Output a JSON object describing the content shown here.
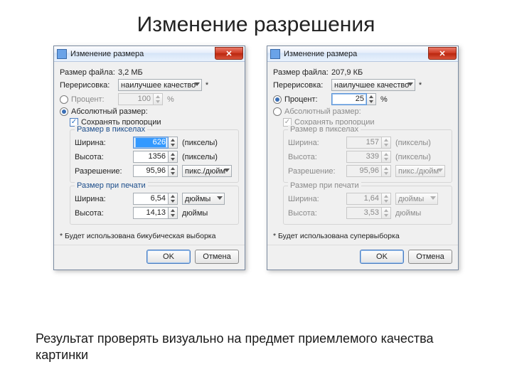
{
  "slide_title": "Изменение разрешения",
  "caption": "Результат проверять визуально на предмет приемлемого качества картинки",
  "common": {
    "window_title": "Изменение размера",
    "file_size_label": "Размер файла:",
    "resample_label": "Перерисовка:",
    "resample_value": "наилучшее качество",
    "percent_label": "Процент:",
    "percent_unit": "%",
    "absolute_label": "Абсолютный размер:",
    "keep_ratio_label": "Сохранять пропорции",
    "group_pixels": "Размер в пикселах",
    "group_print": "Размер при печати",
    "width_label": "Ширина:",
    "height_label": "Высота:",
    "resolution_label": "Разрешение:",
    "pixels_unit": "(пикселы)",
    "res_unit": "пикс./дюйм",
    "print_unit": "дюймы",
    "ok": "OK",
    "cancel": "Отмена"
  },
  "left": {
    "file_size_value": "3,2 МБ",
    "percent_value": "100",
    "width_value": "626",
    "height_value": "1356",
    "resolution_value": "95,96",
    "print_width": "6,54",
    "print_height": "14,13",
    "footnote": "* Будет использована бикубическая выборка"
  },
  "right": {
    "file_size_value": "207,9 КБ",
    "percent_value": "25",
    "width_value": "157",
    "height_value": "339",
    "resolution_value": "95,96",
    "print_width": "1,64",
    "print_height": "3,53",
    "footnote": "* Будет использована супервыборка"
  }
}
